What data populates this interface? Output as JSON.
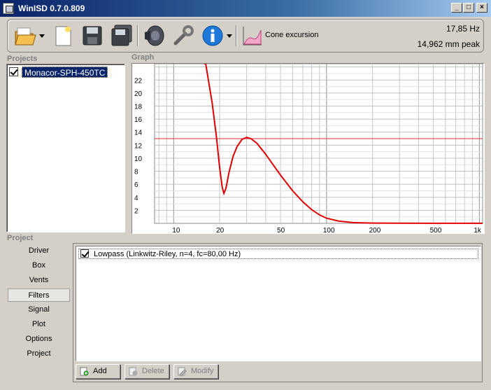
{
  "window": {
    "title": "WinISD 0.7.0.809"
  },
  "toolbar": {
    "cone_excursion_label": "Cone excursion",
    "frequency_readout": "17,85 Hz",
    "excursion_readout": "14,962 mm peak"
  },
  "projects": {
    "label": "Projects",
    "items": [
      {
        "name": "Monacor-SPH-450TC",
        "checked": true
      }
    ]
  },
  "graph": {
    "label": "Graph",
    "y_ticks": [
      "22",
      "20",
      "18",
      "16",
      "14",
      "12",
      "10",
      "8",
      "6",
      "4",
      "2"
    ],
    "x_ticks": [
      "10",
      "20",
      "50",
      "100",
      "200",
      "500",
      "1k"
    ],
    "curve_color": "#e00000",
    "limit_line_value": 13
  },
  "project": {
    "label": "Project",
    "menu": [
      "Driver",
      "Box",
      "Vents",
      "Filters",
      "Signal",
      "Plot",
      "Options",
      "Project"
    ],
    "active": "Filters"
  },
  "filters": {
    "items": [
      {
        "label": "Lowpass (Linkwitz-Riley, n=4, fc=80,00 Hz)",
        "checked": true
      }
    ],
    "add_label": "Add",
    "delete_label": "Delete",
    "modify_label": "Modify"
  }
}
